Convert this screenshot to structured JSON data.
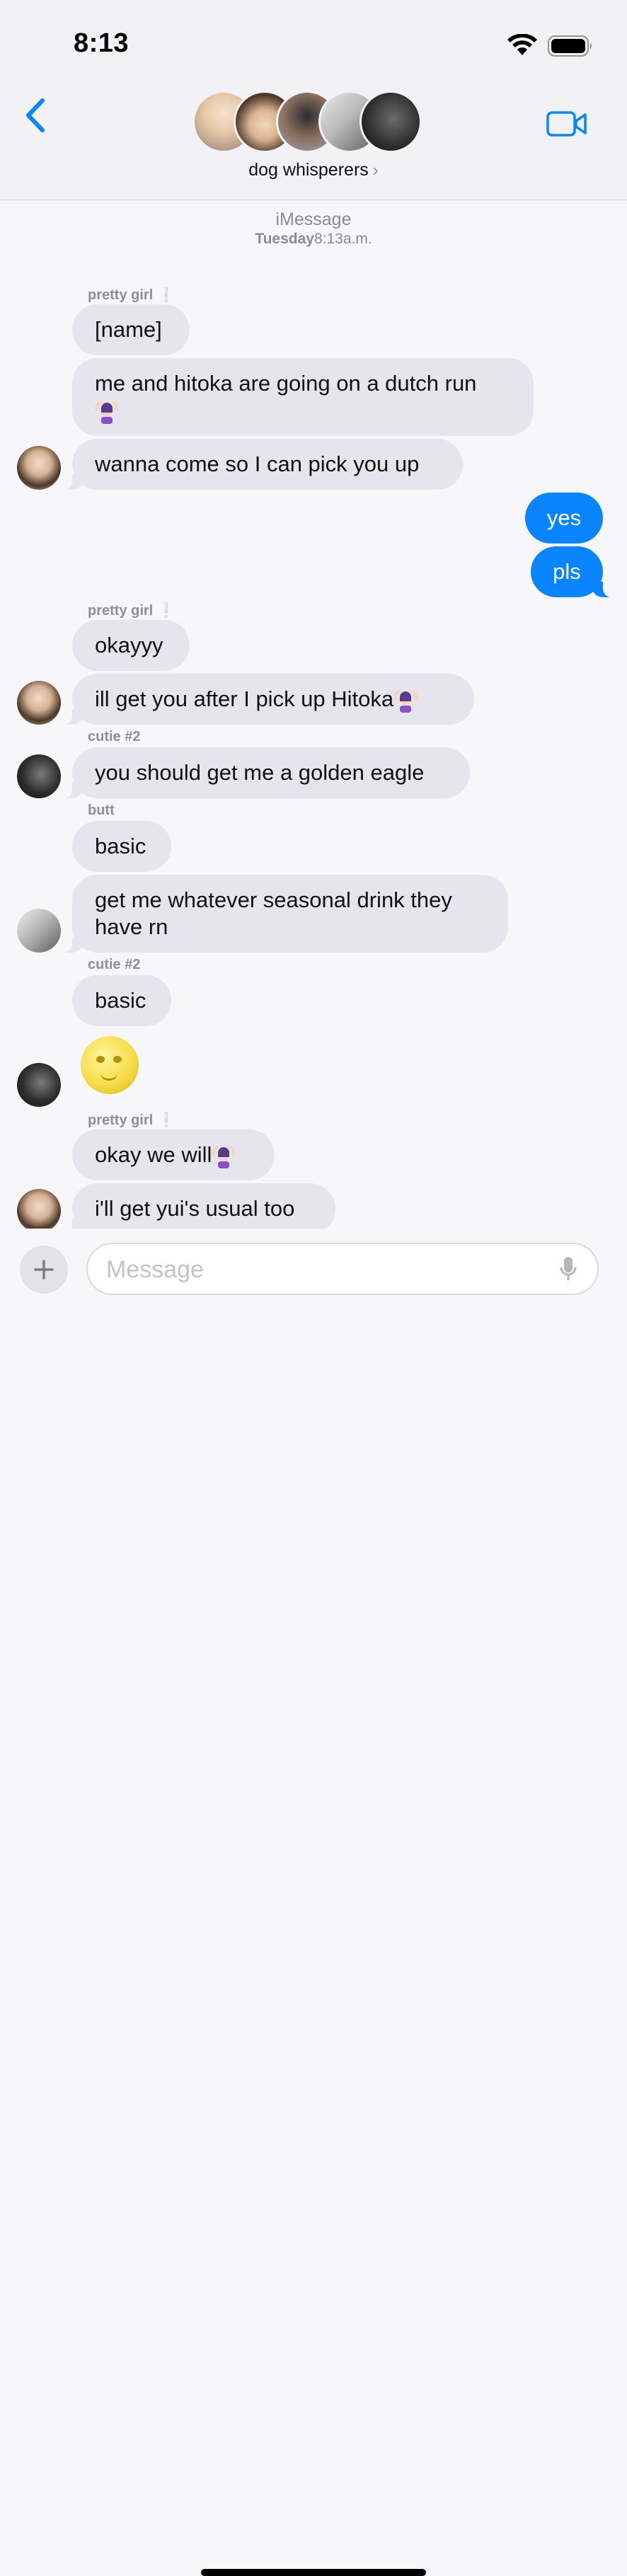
{
  "status_bar": {
    "time": "8:13"
  },
  "header": {
    "group_name": "dog whisperers",
    "chevron": "›"
  },
  "service": {
    "label": "iMessage",
    "day": "Tuesday",
    "time": "8:13a.m."
  },
  "senders": {
    "s1": "pretty girl",
    "s2": "pretty girl",
    "s3": "cutie #2",
    "s4": "butt",
    "s5": "cutie #2",
    "s6": "pretty girl"
  },
  "messages": {
    "m1": "[name]",
    "m2": "me and hitoka are going on a dutch run",
    "m3": "wanna come so I can pick you up",
    "m4": "yes",
    "m5": "pls",
    "m6": "okayyy",
    "m7": "ill get you after I pick up Hitoka",
    "m8": "you should get me a golden eagle",
    "m9": "basic",
    "m10": "get me whatever seasonal drink they have rn",
    "m11": "basic",
    "m12": "okay we will",
    "m13": "i'll get yui's usual too"
  },
  "input": {
    "placeholder": "Message"
  },
  "icons": {
    "back": "chevron-left-icon",
    "video": "video-camera-icon",
    "plus": "plus-icon",
    "mic": "microphone-icon",
    "moon_emoji": "full-moon-face-icon",
    "woman_emoji": "woman-gesturing-ok-icon"
  },
  "colors": {
    "accent": "#0a84ff",
    "incoming_bubble": "#e6e4ec",
    "background": "#f7f7f9"
  }
}
